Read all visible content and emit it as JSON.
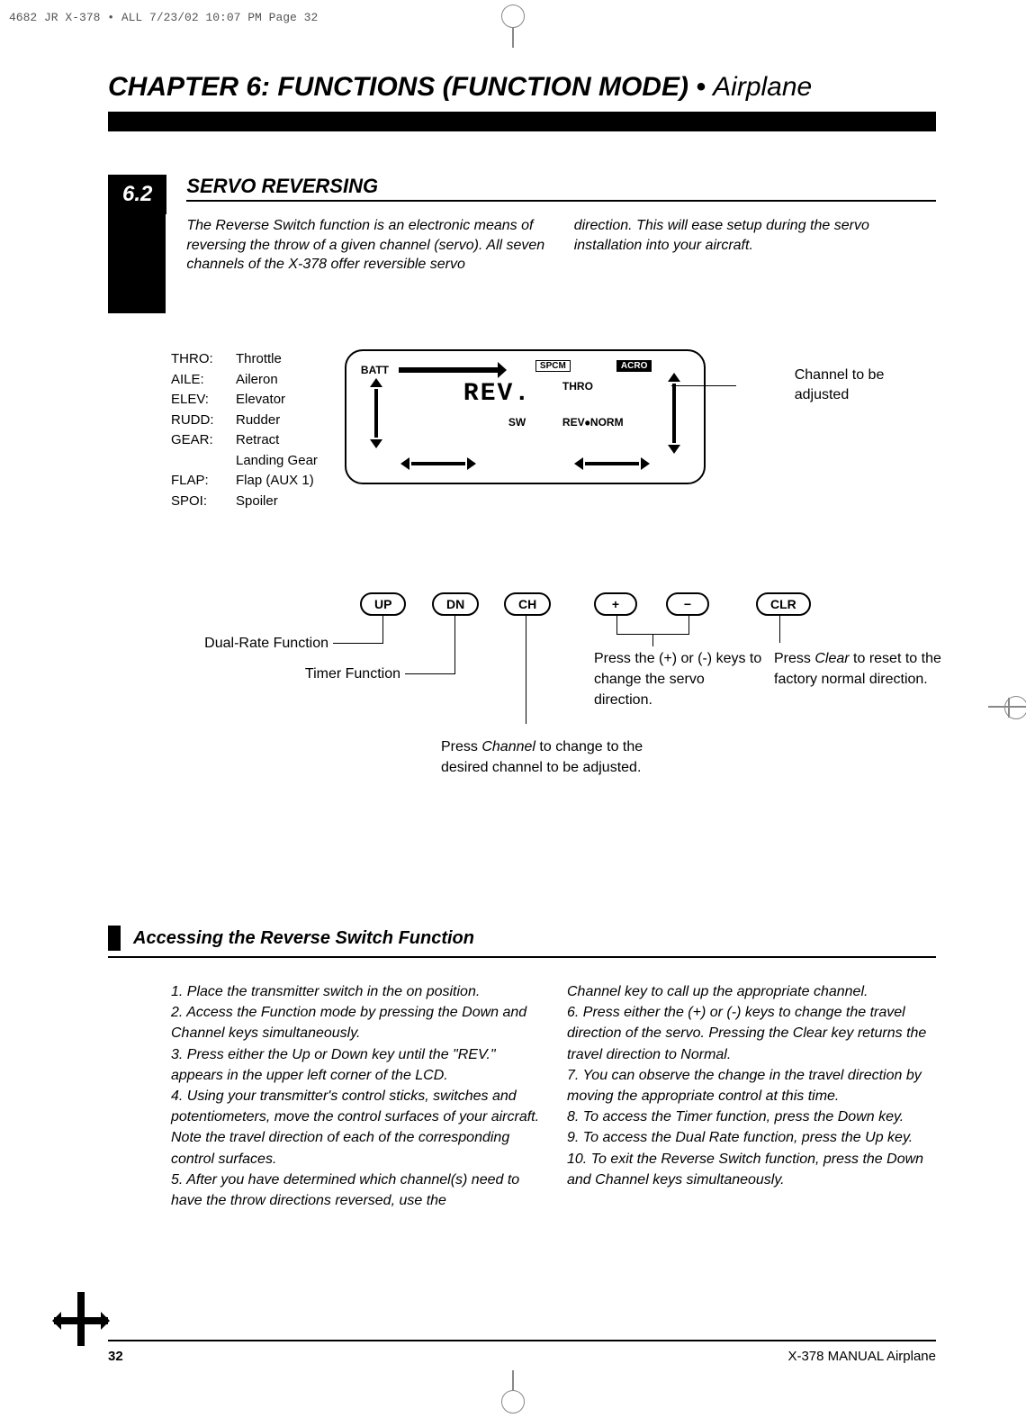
{
  "print_slug": "4682 JR X-378 • ALL  7/23/02  10:07 PM  Page 32",
  "chapter": {
    "strong": "CHAPTER 6: FUNCTIONS (FUNCTION MODE)",
    "sep": " • ",
    "light": "Airplane"
  },
  "section": {
    "number": "6.2",
    "title": "SERVO REVERSING",
    "para_left": "The Reverse Switch function is an electronic means of reversing the throw of a given channel (servo). All seven channels of the X-378 offer reversible servo",
    "para_right": "direction. This will ease setup during the servo installation into your aircraft."
  },
  "channels": [
    {
      "k": "THRO:",
      "v": "Throttle"
    },
    {
      "k": "AILE:",
      "v": "Aileron"
    },
    {
      "k": "ELEV:",
      "v": "Elevator"
    },
    {
      "k": "RUDD:",
      "v": "Rudder"
    },
    {
      "k": "GEAR:",
      "v": "Retract"
    },
    {
      "k": "",
      "v": "Landing Gear"
    },
    {
      "k": "FLAP:",
      "v": "Flap (AUX 1)"
    },
    {
      "k": "SPOI:",
      "v": "Spoiler"
    }
  ],
  "lcd": {
    "batt": "BATT",
    "spcm": "SPCM",
    "acro": "ACRO",
    "rev": "REV.",
    "thro": "THRO",
    "sw": "SW",
    "revnorm_left": "REV",
    "revnorm_right": "NORM",
    "callout": "Channel to be adjusted"
  },
  "keys": {
    "up": "UP",
    "dn": "DN",
    "ch": "CH",
    "plus": "+",
    "minus": "−",
    "clr": "CLR"
  },
  "captions": {
    "dual_rate": "Dual-Rate Function",
    "timer": "Timer Function",
    "ch_press_a": "Press ",
    "ch_press_i": "Channel",
    "ch_press_b": " to change to the desired channel to be adjusted.",
    "pm_press": "Press the (+) or (-) keys to change the servo direction.",
    "clr_press_a": "Press ",
    "clr_press_i": "Clear",
    "clr_press_b": " to reset to the factory normal direction."
  },
  "subsection": {
    "title": "Accessing the Reverse Switch Function",
    "left": "1. Place the transmitter switch in the on position.\n2. Access the Function mode by pressing the Down and Channel keys simultaneously.\n3. Press either the Up or Down key until the \"REV.\" appears in the upper left corner of the LCD.\n4. Using your transmitter's control sticks, switches and potentiometers, move the control surfaces of your aircraft. Note the travel direction of each of the corresponding control surfaces.\n5. After you have determined which channel(s) need to have the throw directions reversed, use the",
    "right": "Channel key to call up the appropriate channel.\n6. Press either the (+) or (-) keys to change the travel direction of the servo. Pressing the Clear key returns the travel direction to Normal.\n7. You can observe the change in the travel direction by moving the appropriate control at this time.\n8. To access the Timer function, press the Down key.\n9. To access the Dual Rate function, press the Up key.\n10. To exit the Reverse Switch function, press the Down and Channel keys simultaneously."
  },
  "footer": {
    "page": "32",
    "manual": "X-378  MANUAL Airplane"
  }
}
